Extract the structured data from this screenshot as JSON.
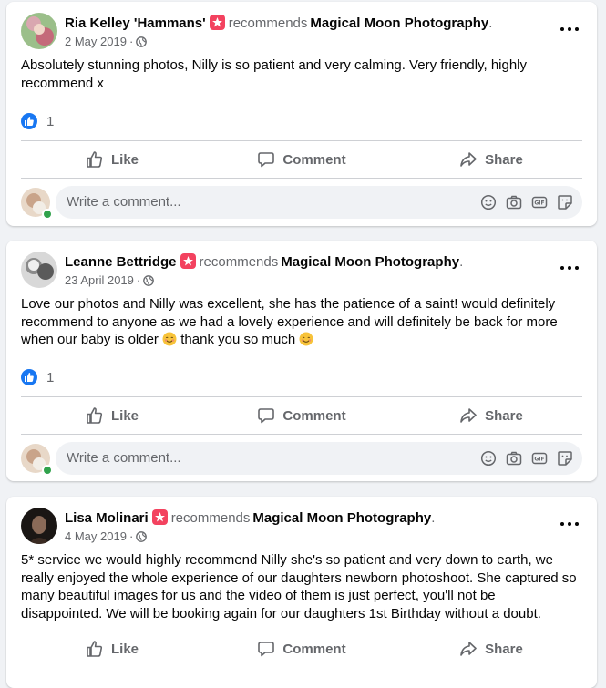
{
  "reviews": [
    {
      "author": "Ria Kelley 'Hammans'",
      "verb": "recommends",
      "page": "Magical Moon Photography",
      "period": ".",
      "date": "2 May 2019",
      "dot": "·",
      "text": "Absolutely stunning photos, Nilly is so patient and very calming. Very friendly, highly recommend x",
      "reaction_count": "1",
      "comment_placeholder": "Write a comment..."
    },
    {
      "author": "Leanne Bettridge",
      "verb": "recommends",
      "page": "Magical Moon Photography",
      "period": ".",
      "date": "23 April 2019",
      "dot": "·",
      "text_part1": "Love our photos and Nilly was excellent, she has the patience of a saint! would definitely recommend to anyone as we had a lovely experience and will definitely be back for more when our baby is older ",
      "text_part2": " thank you so much ",
      "reaction_count": "1",
      "comment_placeholder": "Write a comment..."
    },
    {
      "author": "Lisa Molinari",
      "verb": "recommends",
      "page": "Magical Moon Photography",
      "period": ".",
      "date": "4 May 2019",
      "dot": "·",
      "text": "5* service we would highly recommend Nilly she's so patient and very down to earth, we really enjoyed the whole experience of our daughters newborn photoshoot. She captured so many beautiful images for us and the video of them is just perfect, you'll not be disappointed. We will be booking again for our daughters 1st Birthday without a doubt."
    }
  ],
  "actions": {
    "like": "Like",
    "comment": "Comment",
    "share": "Share"
  },
  "colors": {
    "recommend_badge": "#f3425f",
    "like_blue": "#1877f2",
    "online_green": "#31a24c"
  },
  "icons": [
    "recommend-icon",
    "globe-icon",
    "more-icon",
    "like-badge-icon",
    "like-icon",
    "comment-icon",
    "share-icon",
    "smiley-icon",
    "camera-icon",
    "gif-icon",
    "sticker-icon"
  ]
}
